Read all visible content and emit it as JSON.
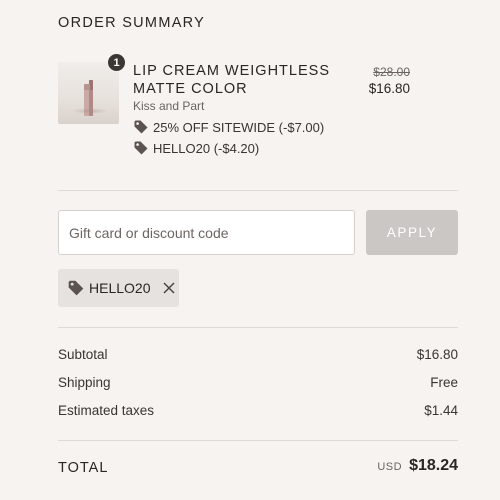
{
  "summary": {
    "title": "ORDER SUMMARY"
  },
  "item": {
    "quantity": "1",
    "name": "LIP CREAM WEIGHTLESS MATTE COLOR",
    "brand": "Kiss and Part",
    "original_price": "$28.00",
    "price": "$16.80",
    "discounts": [
      {
        "label": "25% OFF SITEWIDE (-$7.00)",
        "icon": "tag-icon"
      },
      {
        "label": "HELLO20 (-$4.20)",
        "icon": "tag-icon"
      }
    ]
  },
  "discount_form": {
    "placeholder": "Gift card or discount code",
    "apply_label": "APPLY"
  },
  "applied_code": {
    "label": "HELLO20",
    "icon": "tag-icon",
    "remove_icon": "close-icon"
  },
  "totals": {
    "subtotal_label": "Subtotal",
    "subtotal_value": "$16.80",
    "shipping_label": "Shipping",
    "shipping_value": "Free",
    "taxes_label": "Estimated taxes",
    "taxes_value": "$1.44",
    "total_label": "TOTAL",
    "currency": "USD",
    "total_value": "$18.24"
  },
  "colors": {
    "background": "#f6f3f0",
    "text": "#2b2523",
    "apply_button": "#cbc7c4",
    "chip": "#e6e2df"
  }
}
